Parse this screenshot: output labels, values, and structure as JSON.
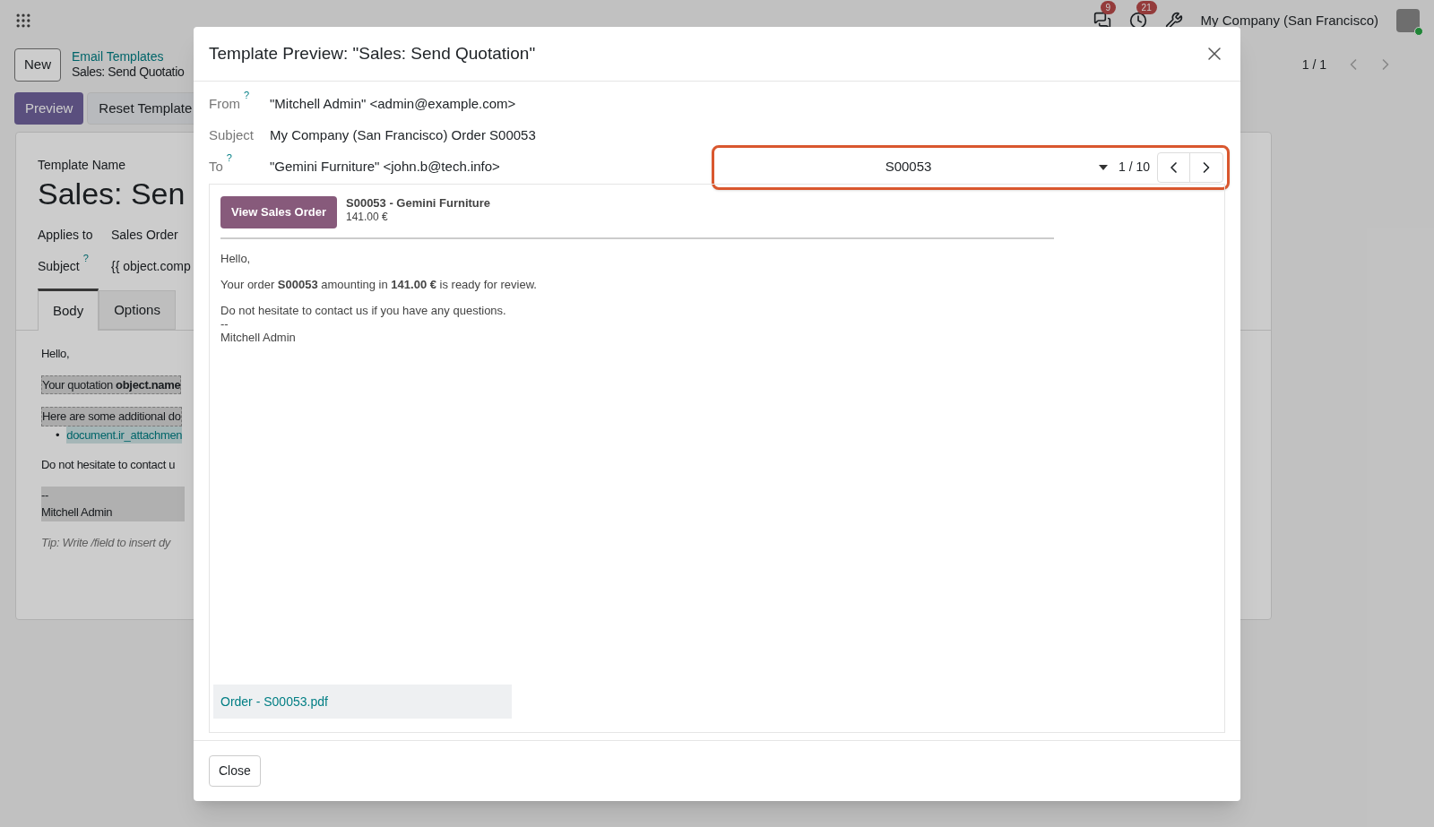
{
  "topbar": {
    "messages_badge": "9",
    "activities_badge": "21",
    "company": "My Company (San Francisco)"
  },
  "control_panel": {
    "new_button": "New",
    "breadcrumb_parent": "Email Templates",
    "breadcrumb_current": "Sales: Send Quotatio",
    "pager": "1 / 1",
    "actions": [
      {
        "label": "Preview",
        "kind": "primary"
      },
      {
        "label": "Reset Template",
        "kind": "secondary"
      }
    ]
  },
  "form": {
    "name_label": "Template Name",
    "name": "Sales: Sen",
    "fields": [
      {
        "label": "Applies to",
        "value": "Sales Order"
      },
      {
        "label": "Subject",
        "help": "?",
        "value": "{{ object.comp"
      }
    ],
    "tabs": [
      {
        "label": "Body",
        "selected": true
      },
      {
        "label": "Options",
        "selected": false
      }
    ],
    "body": [
      {
        "kind": "plain",
        "lines": [
          "Hello,"
        ]
      },
      {
        "kind": "highlight",
        "lines": [
          "Your quotation **object.name**"
        ]
      },
      {
        "kind": "highlight",
        "lines": [
          "Here are some additional do"
        ]
      },
      {
        "kind": "link_item",
        "bullet": "•",
        "lines": [
          "document.ir_attachmen"
        ]
      },
      {
        "kind": "plain",
        "lines": [
          "Do not hesitate to contact u"
        ]
      },
      {
        "kind": "signature",
        "lines": [
          "--",
          "Mitchell Admin"
        ]
      }
    ],
    "tip": "Tip: Write /field to insert dy"
  },
  "dialog": {
    "title": "Template Preview: \"Sales: Send Quotation\"",
    "fields": [
      {
        "label": "From",
        "help": "?",
        "value": "\"Mitchell Admin\" <admin@example.com>"
      },
      {
        "label": "Subject",
        "value": "My Company (San Francisco) Order S00053"
      },
      {
        "label": "To",
        "help": "?",
        "value": "\"Gemini Furniture\" <john.b@tech.info>"
      }
    ],
    "record_selector": {
      "value": "S00053",
      "counter": "1 / 10",
      "highlighted": true
    },
    "email": {
      "button": "View Sales Order",
      "heading": "S00053 - Gemini Furniture",
      "amount": "141.00 €",
      "paragraphs": [
        {
          "lines": [
            "Hello,"
          ]
        },
        {
          "lines": [
            "Your order **S00053** amounting in **141.00 €** is ready for review."
          ]
        },
        {
          "lines": [
            "Do not hesitate to contact us if you have any questions.",
            "--",
            "Mitchell Admin"
          ]
        }
      ],
      "attachment": "Order - S00053.pdf"
    },
    "close_button": "Close"
  }
}
